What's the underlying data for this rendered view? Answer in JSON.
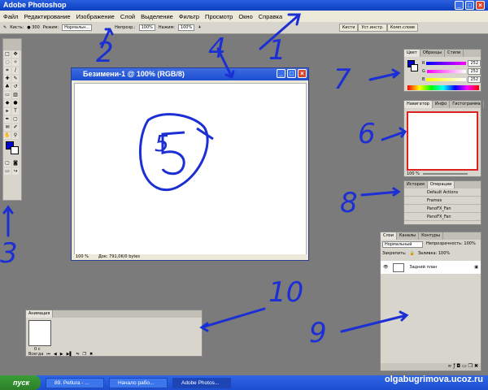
{
  "window": {
    "title": "Adobe Photoshop"
  },
  "menu": [
    "Файл",
    "Редактирование",
    "Изображение",
    "Слой",
    "Выделение",
    "Фильтр",
    "Просмотр",
    "Окно",
    "Справка"
  ],
  "options": {
    "brush_label": "Кисть:",
    "brush_size": "300",
    "mode_label": "Режим:",
    "mode_value": "Нормальн...",
    "opacity_label": "Непрозр.:",
    "opacity_value": "100%",
    "flow_label": "Нажим:",
    "flow_value": "100%",
    "tabs": [
      "Кисти",
      "Уст.инстр.",
      "Комп.слоев"
    ]
  },
  "document": {
    "title": "Безимени-1 @ 100% (RGB/8)",
    "zoom": "100 %",
    "doc_info": "Док: 791,0K/0 bytes"
  },
  "panels": {
    "color": {
      "tabs": [
        "Цвет",
        "Образцы",
        "Стили"
      ],
      "channels": [
        {
          "l": "R",
          "v": "252"
        },
        {
          "l": "G",
          "v": "252"
        },
        {
          "l": "B",
          "v": "252"
        }
      ]
    },
    "navigator": {
      "tabs": [
        "Навигатор",
        "Инфо",
        "Гистограмма"
      ],
      "zoom": "100 %"
    },
    "actions": {
      "tabs": [
        "История",
        "Операции"
      ],
      "items": [
        "Default Actions",
        "Frames",
        "PanoFX_Fan",
        "PanoFX_Fan"
      ]
    },
    "layers": {
      "tabs": [
        "Слои",
        "Каналы",
        "Контуры"
      ],
      "blend": "Нормальный",
      "opacity_label": "Непрозрачность: 100%",
      "lock_label": "Закрепить:",
      "fill_label": "Заливка: 100%",
      "layer_name": "Задний план"
    },
    "animation": {
      "tab": "Анимация",
      "frame_time": "0 с",
      "loop": "Всегда"
    }
  },
  "taskbar": {
    "start": "пуск",
    "tasks": [
      "89. Petlura - ...",
      "Начало рабо...",
      "Adobe Photos..."
    ],
    "watermark": "olgabugrimova.ucoz.ru"
  },
  "annotations": [
    "1",
    "2",
    "3",
    "4",
    "5",
    "6",
    "7",
    "8",
    "9",
    "10"
  ],
  "colors": {
    "accent": "#1b2fd4",
    "fg": "#0000cc"
  }
}
